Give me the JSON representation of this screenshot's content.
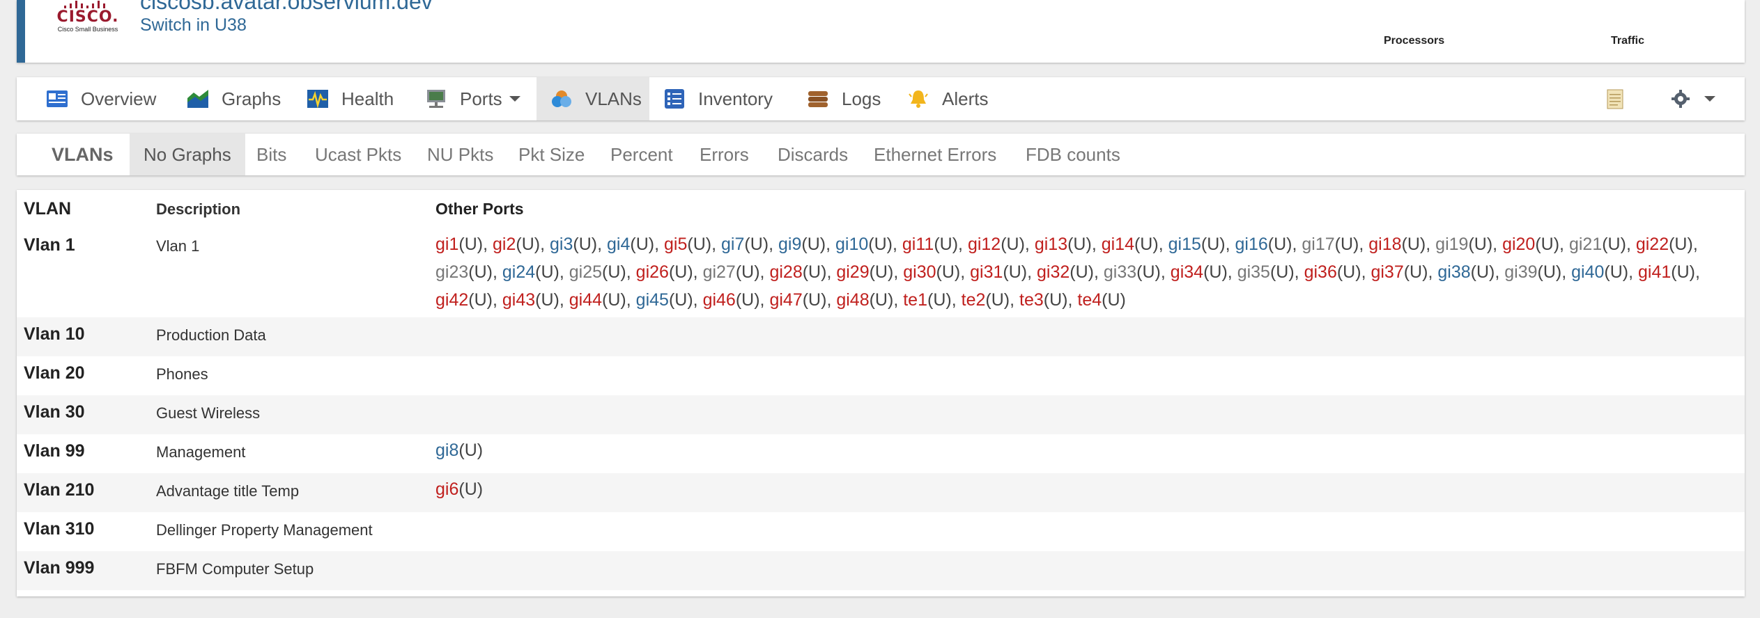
{
  "device": {
    "logo": {
      "word": "CISCO.",
      "sub": "Cisco Small Business"
    },
    "hostname": "ciscosb.avatar.observium.dev",
    "location": "Switch in U38",
    "columns": [
      "Processors",
      "Traffic"
    ]
  },
  "nav": {
    "items": [
      {
        "label": "Overview",
        "icon": "overview-icon"
      },
      {
        "label": "Graphs",
        "icon": "graphs-icon"
      },
      {
        "label": "Health",
        "icon": "health-icon"
      },
      {
        "label": "Ports",
        "icon": "ports-icon"
      },
      {
        "label": "VLANs",
        "icon": "vlans-icon"
      },
      {
        "label": "Inventory",
        "icon": "inventory-icon"
      },
      {
        "label": "Logs",
        "icon": "logs-icon"
      },
      {
        "label": "Alerts",
        "icon": "alerts-icon"
      }
    ],
    "active": "VLANs",
    "right_icons": [
      "notepad-icon",
      "gear-icon"
    ]
  },
  "subnav": {
    "brand": "VLANs",
    "items": [
      "No Graphs",
      "Bits",
      "Ucast Pkts",
      "NU Pkts",
      "Pkt Size",
      "Percent",
      "Errors",
      "Discards",
      "Ethernet Errors",
      "FDB counts"
    ],
    "active": "No Graphs"
  },
  "colors": {
    "port_up": "#c0201e",
    "port_link": "#2f6896",
    "port_down": "#777777",
    "accent": "#2f6896"
  },
  "table": {
    "headers": [
      "VLAN",
      "Description",
      "Other Ports"
    ],
    "untagged_suffix": "(U)",
    "rows": [
      {
        "vlan": "Vlan 1",
        "description": "Vlan 1",
        "ports": [
          {
            "n": "gi1",
            "s": "red"
          },
          {
            "n": "gi2",
            "s": "red"
          },
          {
            "n": "gi3",
            "s": "blue"
          },
          {
            "n": "gi4",
            "s": "blue"
          },
          {
            "n": "gi5",
            "s": "red"
          },
          {
            "n": "gi7",
            "s": "blue"
          },
          {
            "n": "gi9",
            "s": "blue"
          },
          {
            "n": "gi10",
            "s": "blue"
          },
          {
            "n": "gi11",
            "s": "red"
          },
          {
            "n": "gi12",
            "s": "red"
          },
          {
            "n": "gi13",
            "s": "red"
          },
          {
            "n": "gi14",
            "s": "red"
          },
          {
            "n": "gi15",
            "s": "blue"
          },
          {
            "n": "gi16",
            "s": "blue"
          },
          {
            "n": "gi17",
            "s": "grey"
          },
          {
            "n": "gi18",
            "s": "red"
          },
          {
            "n": "gi19",
            "s": "grey"
          },
          {
            "n": "gi20",
            "s": "red"
          },
          {
            "n": "gi21",
            "s": "grey"
          },
          {
            "n": "gi22",
            "s": "red"
          },
          {
            "n": "gi23",
            "s": "grey"
          },
          {
            "n": "gi24",
            "s": "blue"
          },
          {
            "n": "gi25",
            "s": "grey"
          },
          {
            "n": "gi26",
            "s": "red"
          },
          {
            "n": "gi27",
            "s": "grey"
          },
          {
            "n": "gi28",
            "s": "red"
          },
          {
            "n": "gi29",
            "s": "red"
          },
          {
            "n": "gi30",
            "s": "red"
          },
          {
            "n": "gi31",
            "s": "red"
          },
          {
            "n": "gi32",
            "s": "red"
          },
          {
            "n": "gi33",
            "s": "grey"
          },
          {
            "n": "gi34",
            "s": "red"
          },
          {
            "n": "gi35",
            "s": "grey"
          },
          {
            "n": "gi36",
            "s": "red"
          },
          {
            "n": "gi37",
            "s": "red"
          },
          {
            "n": "gi38",
            "s": "blue"
          },
          {
            "n": "gi39",
            "s": "grey"
          },
          {
            "n": "gi40",
            "s": "blue"
          },
          {
            "n": "gi41",
            "s": "red"
          },
          {
            "n": "gi42",
            "s": "red"
          },
          {
            "n": "gi43",
            "s": "red"
          },
          {
            "n": "gi44",
            "s": "red"
          },
          {
            "n": "gi45",
            "s": "blue"
          },
          {
            "n": "gi46",
            "s": "red"
          },
          {
            "n": "gi47",
            "s": "red"
          },
          {
            "n": "gi48",
            "s": "red"
          },
          {
            "n": "te1",
            "s": "red"
          },
          {
            "n": "te2",
            "s": "red"
          },
          {
            "n": "te3",
            "s": "red"
          },
          {
            "n": "te4",
            "s": "red"
          }
        ]
      },
      {
        "vlan": "Vlan 10",
        "description": "Production Data",
        "ports": []
      },
      {
        "vlan": "Vlan 20",
        "description": "Phones",
        "ports": []
      },
      {
        "vlan": "Vlan 30",
        "description": "Guest Wireless",
        "ports": []
      },
      {
        "vlan": "Vlan 99",
        "description": "Management",
        "ports": [
          {
            "n": "gi8",
            "s": "blue"
          }
        ]
      },
      {
        "vlan": "Vlan 210",
        "description": "Advantage title Temp",
        "ports": [
          {
            "n": "gi6",
            "s": "red"
          }
        ]
      },
      {
        "vlan": "Vlan 310",
        "description": "Dellinger Property Management",
        "ports": []
      },
      {
        "vlan": "Vlan 999",
        "description": "FBFM Computer Setup",
        "ports": []
      }
    ]
  }
}
